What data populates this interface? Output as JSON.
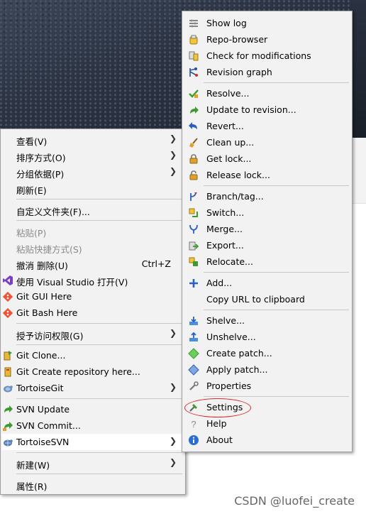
{
  "explorer_menu": {
    "items": [
      {
        "label": "查看(V)",
        "submenu": true
      },
      {
        "label": "排序方式(O)",
        "submenu": true
      },
      {
        "label": "分组依据(P)",
        "submenu": true
      },
      {
        "label": "刷新(E)"
      },
      {
        "label": "自定义文件夹(F)..."
      },
      {
        "label": "粘贴(P)",
        "disabled": true
      },
      {
        "label": "粘贴快捷方式(S)",
        "disabled": true
      },
      {
        "label": "撤消 删除(U)",
        "shortcut": "Ctrl+Z"
      },
      {
        "label": "使用 Visual Studio 打开(V)",
        "icon": "visual-studio-icon"
      },
      {
        "label": "Git GUI Here",
        "icon": "git-icon"
      },
      {
        "label": "Git Bash Here",
        "icon": "git-icon"
      },
      {
        "label": "授予访问权限(G)",
        "submenu": true
      },
      {
        "label": "Git Clone...",
        "icon": "tortoisegit-clone-icon"
      },
      {
        "label": "Git Create repository here...",
        "icon": "tortoisegit-create-repo-icon"
      },
      {
        "label": "TortoiseGit",
        "icon": "tortoisegit-icon",
        "submenu": true
      },
      {
        "label": "SVN Update",
        "icon": "svn-update-icon"
      },
      {
        "label": "SVN Commit...",
        "icon": "svn-commit-icon"
      },
      {
        "label": "TortoiseSVN",
        "icon": "tortoisesvn-icon",
        "submenu": true,
        "highlighted": true
      },
      {
        "label": "新建(W)",
        "submenu": true
      },
      {
        "label": "属性(R)"
      }
    ]
  },
  "svn_submenu": {
    "items": [
      {
        "label": "Show log",
        "icon": "show-log-icon"
      },
      {
        "label": "Repo-browser",
        "icon": "repo-browser-icon"
      },
      {
        "label": "Check for modifications",
        "icon": "check-modifications-icon"
      },
      {
        "label": "Revision graph",
        "icon": "revision-graph-icon"
      },
      {
        "label": "Resolve...",
        "icon": "resolve-icon"
      },
      {
        "label": "Update to revision...",
        "icon": "update-to-revision-icon"
      },
      {
        "label": "Revert...",
        "icon": "revert-icon"
      },
      {
        "label": "Clean up...",
        "icon": "cleanup-icon"
      },
      {
        "label": "Get lock...",
        "icon": "get-lock-icon"
      },
      {
        "label": "Release lock...",
        "icon": "release-lock-icon"
      },
      {
        "label": "Branch/tag...",
        "icon": "branch-tag-icon"
      },
      {
        "label": "Switch...",
        "icon": "switch-icon"
      },
      {
        "label": "Merge...",
        "icon": "merge-icon"
      },
      {
        "label": "Export...",
        "icon": "export-icon"
      },
      {
        "label": "Relocate...",
        "icon": "relocate-icon"
      },
      {
        "label": "Add...",
        "icon": "add-icon"
      },
      {
        "label": "Copy URL to clipboard",
        "icon": "copy-url-icon"
      },
      {
        "label": "Shelve...",
        "icon": "shelve-icon"
      },
      {
        "label": "Unshelve...",
        "icon": "unshelve-icon"
      },
      {
        "label": "Create patch...",
        "icon": "create-patch-icon"
      },
      {
        "label": "Apply patch...",
        "icon": "apply-patch-icon"
      },
      {
        "label": "Properties",
        "icon": "properties-icon"
      },
      {
        "label": "Settings",
        "icon": "settings-icon",
        "circled": true
      },
      {
        "label": "Help",
        "icon": "help-icon"
      },
      {
        "label": "About",
        "icon": "about-icon"
      }
    ]
  },
  "colors": {
    "highlight": "#ffffff",
    "annotation": "#d8262a",
    "menu_bg": "#f2f2f2"
  },
  "watermark": "CSDN @luofei_create"
}
